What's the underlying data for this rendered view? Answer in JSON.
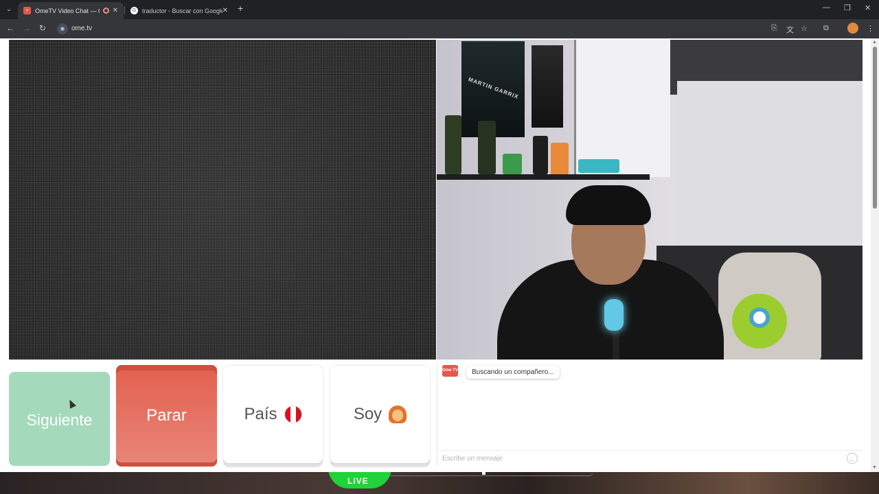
{
  "browser": {
    "tabs": [
      {
        "title": "OmeTV Video Chat — Ome",
        "active": true
      },
      {
        "title": "traductor - Buscar con Google",
        "active": false
      }
    ],
    "url": "ome.tv"
  },
  "poster": {
    "text": "MARTIN GARRIX"
  },
  "controls": {
    "next_label": "Siguiente",
    "stop_label": "Parar",
    "country_label": "País",
    "gender_label": "Soy"
  },
  "chat": {
    "logo_text": "Ome TV",
    "status_message": "Buscando un compañero...",
    "input_placeholder": "Escribe un mensaje"
  },
  "footer": {
    "live_label": "LIVE"
  },
  "colors": {
    "next": "#a4d9bc",
    "stop": "#e2604e",
    "live": "#1fd338"
  }
}
